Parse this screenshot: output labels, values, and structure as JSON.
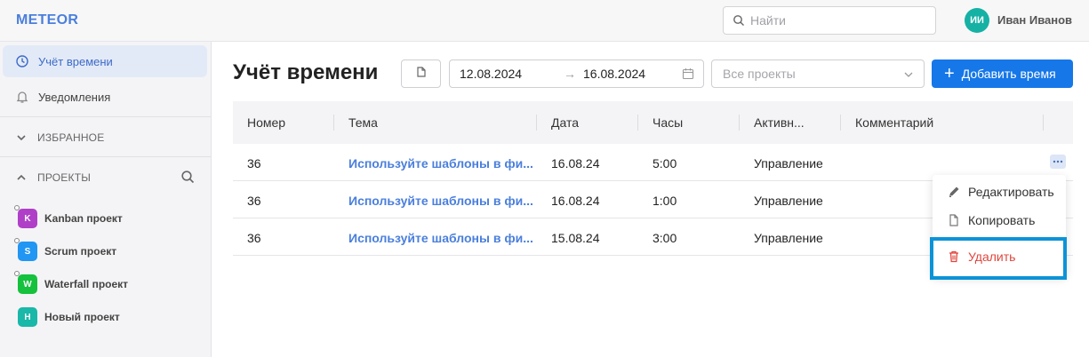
{
  "header": {
    "logo": "METEOR",
    "search_placeholder": "Найти",
    "avatar_initials": "ИИ",
    "user_name": "Иван Иванов"
  },
  "sidebar": {
    "nav": [
      {
        "label": "Учёт времени",
        "icon": "clock-icon",
        "active": true
      },
      {
        "label": "Уведомления",
        "icon": "bell-icon",
        "active": false
      }
    ],
    "favorites_label": "ИЗБРАННОЕ",
    "projects_label": "ПРОЕКТЫ",
    "projects": [
      {
        "letter": "K",
        "name": "Kanban проект",
        "color": "#b03fc8"
      },
      {
        "letter": "S",
        "name": "Scrum проект",
        "color": "#2196f3"
      },
      {
        "letter": "W",
        "name": "Waterfall проект",
        "color": "#15c13d"
      },
      {
        "letter": "Н",
        "name": "Новый проект",
        "color": "#19b8a8"
      }
    ]
  },
  "main": {
    "title": "Учёт времени",
    "date_from": "12.08.2024",
    "date_arrow": "→",
    "date_to": "16.08.2024",
    "project_placeholder": "Все проекты",
    "add_button": "Добавить время",
    "add_button_plus": "+"
  },
  "table": {
    "columns": [
      "Номер",
      "Тема",
      "Дата",
      "Часы",
      "Активн...",
      "Комментарий"
    ],
    "rows": [
      {
        "number": "36",
        "topic": "Используйте шаблоны в фи...",
        "date": "16.08.24",
        "hours": "5:00",
        "activity": "Управление",
        "comment": ""
      },
      {
        "number": "36",
        "topic": "Используйте шаблоны в фи...",
        "date": "16.08.24",
        "hours": "1:00",
        "activity": "Управление",
        "comment": ""
      },
      {
        "number": "36",
        "topic": "Используйте шаблоны в фи...",
        "date": "15.08.24",
        "hours": "3:00",
        "activity": "Управление",
        "comment": ""
      }
    ]
  },
  "context_menu": {
    "edit": "Редактировать",
    "copy": "Копировать",
    "delete": "Удалить"
  },
  "colors": {
    "accent": "#1677e8",
    "logo": "#4a7fdc",
    "danger": "#e0453d",
    "highlight": "#0c93d7"
  }
}
